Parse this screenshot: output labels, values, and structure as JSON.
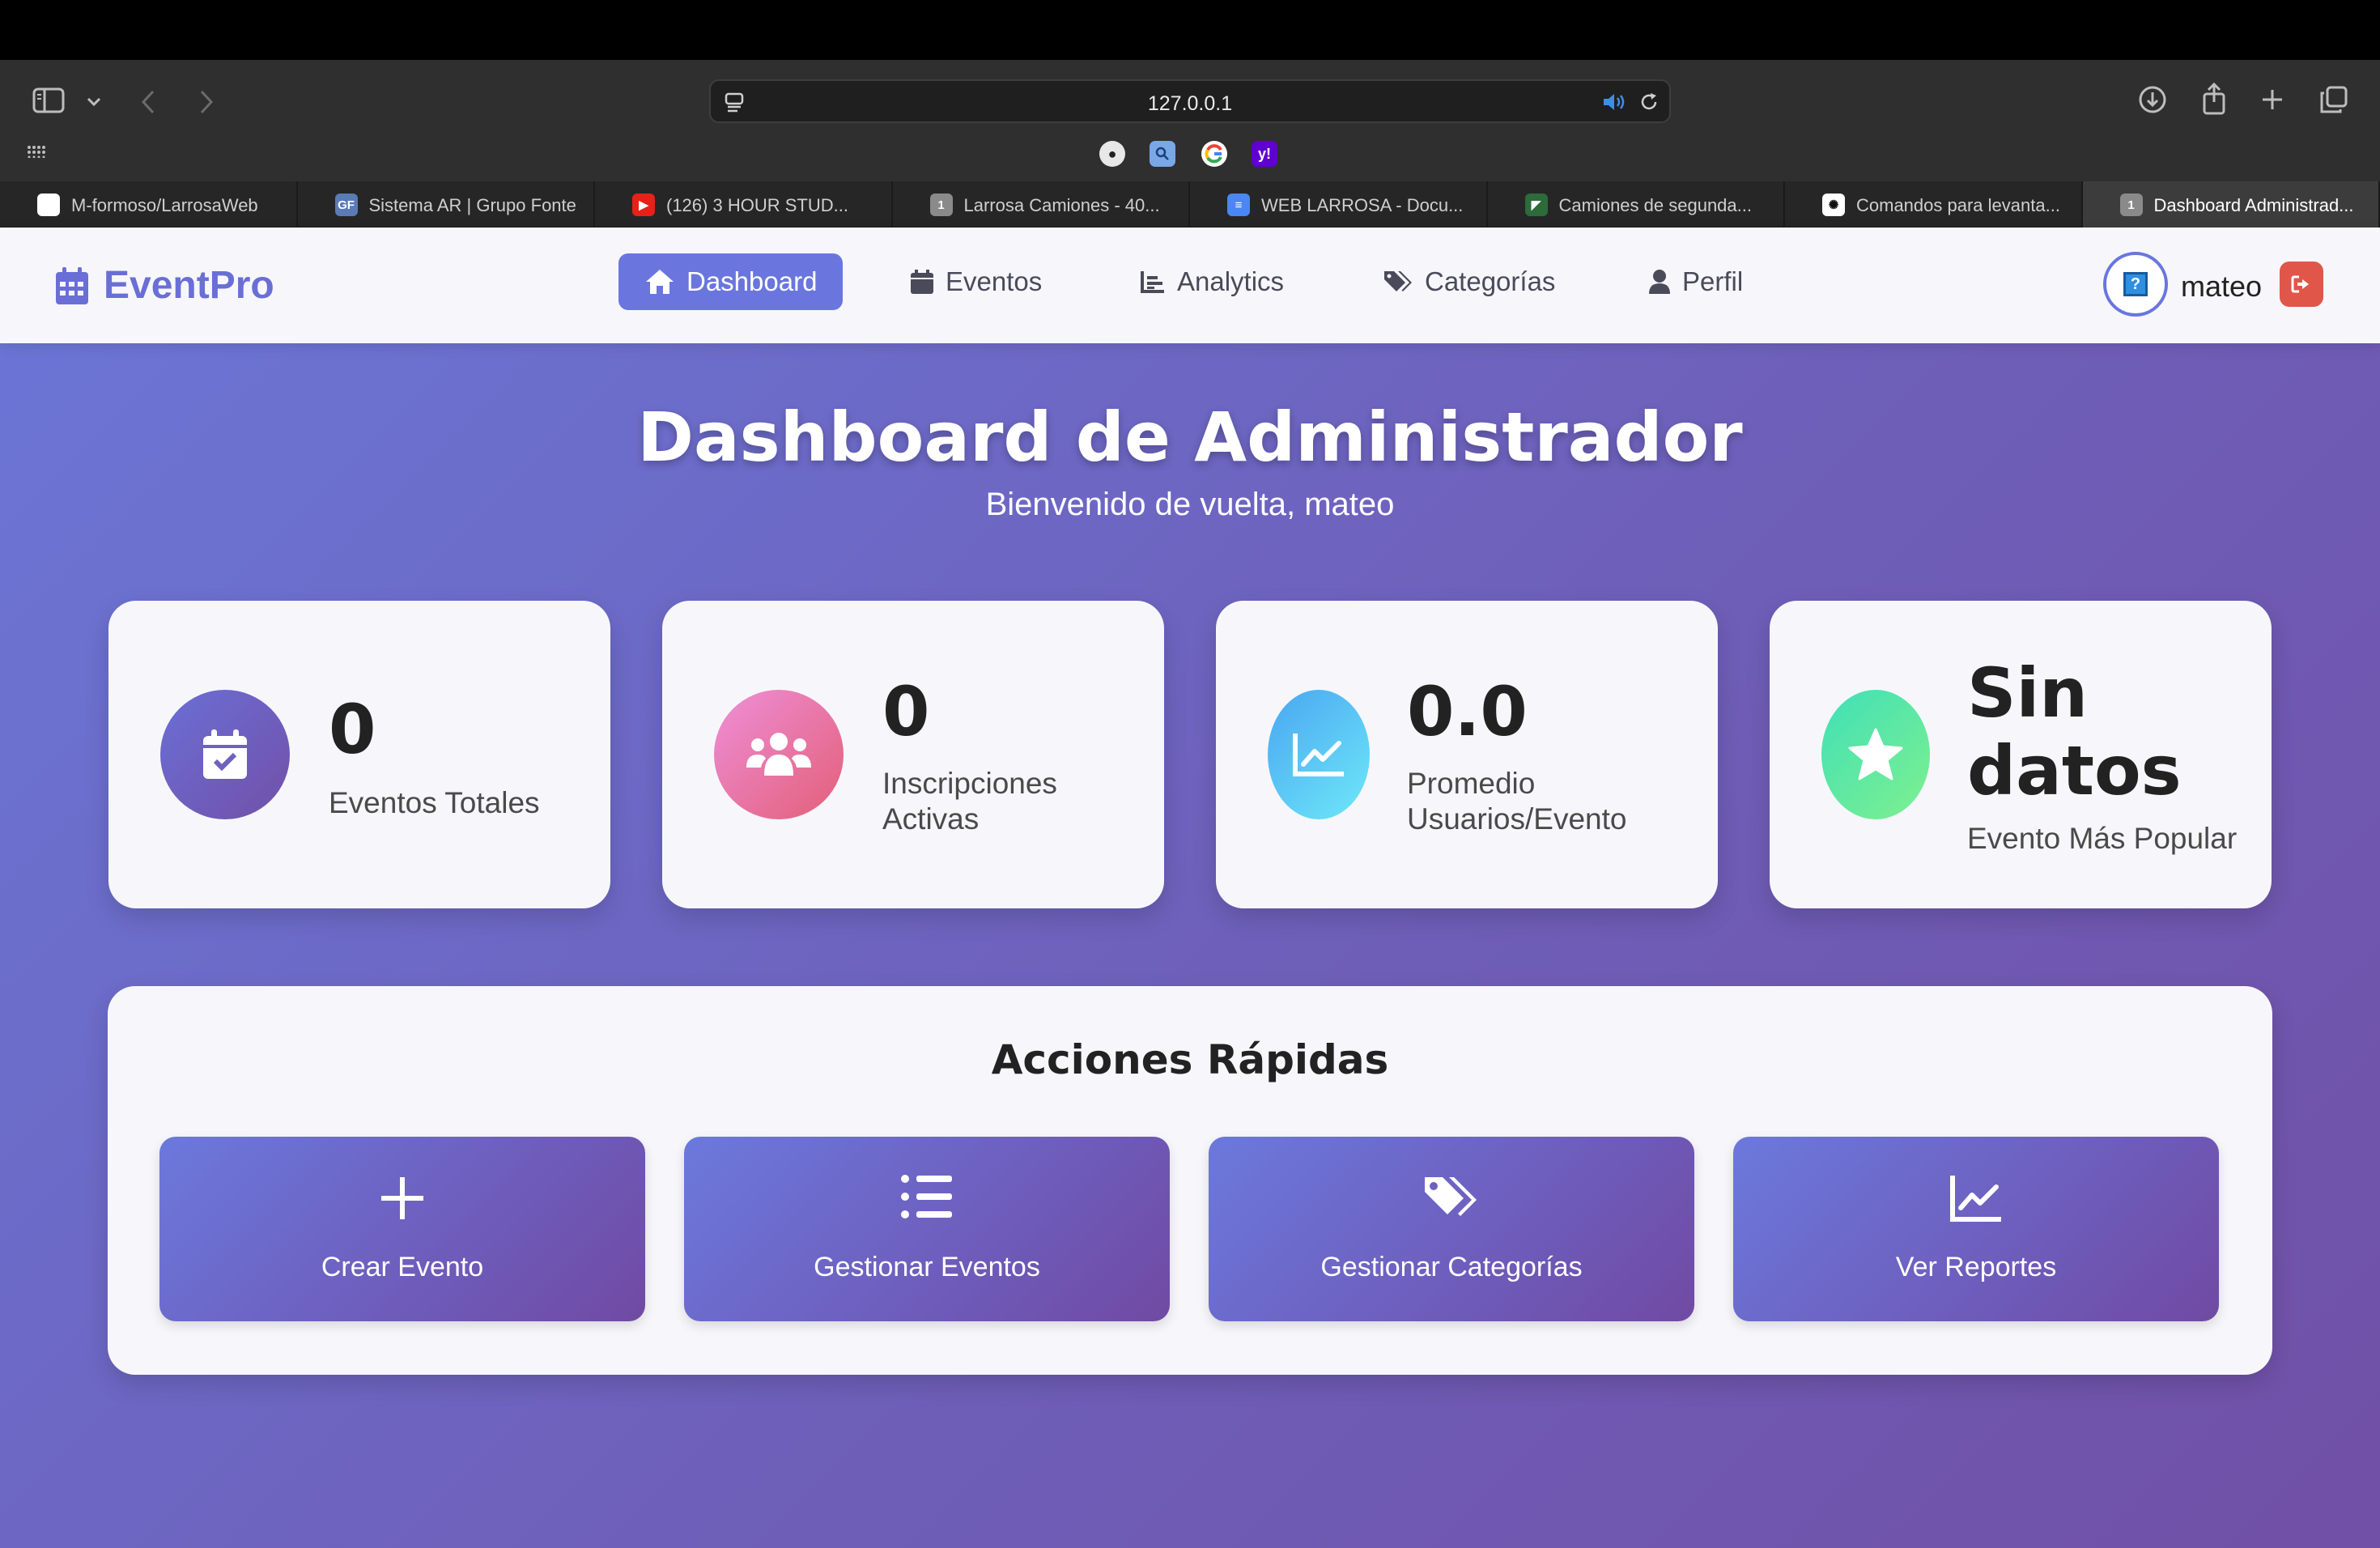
{
  "browser": {
    "url": "127.0.0.1",
    "favorites": [
      {
        "name": "apple-favorite-icon",
        "color": "#e8e8e8"
      },
      {
        "name": "search-favorite-icon",
        "color": "#7aa7e6"
      },
      {
        "name": "google-favorite-icon",
        "color": "#ffffff"
      },
      {
        "name": "yahoo-favorite-icon",
        "color": "#5f01d1"
      }
    ],
    "tabs": [
      {
        "label": "M-formoso/LarrosaWeb",
        "icon": "github-icon",
        "fav_color": "#ffffff",
        "fav_glyph": ""
      },
      {
        "label": "Sistema AR | Grupo Fonte",
        "icon": "grupo-fonte-icon",
        "fav_color": "#5a7bb5",
        "fav_glyph": "GF"
      },
      {
        "label": "(126) 3 HOUR STUD...",
        "icon": "youtube-icon",
        "fav_color": "#e62117",
        "fav_glyph": "▶"
      },
      {
        "label": "Larrosa Camiones - 40...",
        "icon": "tab-group-icon",
        "fav_color": "#8a8a8a",
        "fav_glyph": "1"
      },
      {
        "label": "WEB LARROSA - Docu...",
        "icon": "google-docs-icon",
        "fav_color": "#4a86f5",
        "fav_glyph": "≡"
      },
      {
        "label": "Camiones de segunda...",
        "icon": "site-icon",
        "fav_color": "#2d6b3a",
        "fav_glyph": "◤"
      },
      {
        "label": "Comandos para levanta...",
        "icon": "chatgpt-icon",
        "fav_color": "#ffffff",
        "fav_glyph": "✺"
      },
      {
        "label": "Dashboard Administrad...",
        "icon": "tab-group-icon",
        "fav_color": "#8a8a8a",
        "fav_glyph": "1"
      }
    ]
  },
  "app": {
    "brand": "EventPro",
    "nav": [
      {
        "label": "Dashboard",
        "icon": "home-icon",
        "active": true
      },
      {
        "label": "Eventos",
        "icon": "calendar-icon",
        "active": false
      },
      {
        "label": "Analytics",
        "icon": "chart-icon",
        "active": false
      },
      {
        "label": "Categorías",
        "icon": "tags-icon",
        "active": false
      },
      {
        "label": "Perfil",
        "icon": "user-icon",
        "active": false
      }
    ],
    "user": {
      "name": "mateo",
      "avatar_glyph": "?"
    }
  },
  "hero": {
    "title": "Dashboard de Administrador",
    "subtitle": "Bienvenido de vuelta, mateo"
  },
  "stats": [
    {
      "value": "0",
      "label": "Eventos Totales",
      "icon": "calendar-check-icon"
    },
    {
      "value": "0",
      "label": "Inscripciones Activas",
      "icon": "users-icon"
    },
    {
      "value": "0.0",
      "label": "Promedio Usuarios/Evento",
      "icon": "line-chart-icon"
    },
    {
      "value": "Sin datos",
      "label": "Evento Más Popular",
      "icon": "star-icon"
    }
  ],
  "quick_actions": {
    "title": "Acciones Rápidas",
    "buttons": [
      {
        "label": "Crear Evento",
        "icon": "plus-icon"
      },
      {
        "label": "Gestionar Eventos",
        "icon": "list-icon"
      },
      {
        "label": "Gestionar Categorías",
        "icon": "tags-icon"
      },
      {
        "label": "Ver Reportes",
        "icon": "line-chart-icon"
      }
    ]
  },
  "colors": {
    "accent": "#6a76de",
    "logout": "#e0574a",
    "stat_gradients": [
      "#6a6fd6",
      "#e9708f",
      "#4fb8f5",
      "#5ee5a0"
    ]
  }
}
